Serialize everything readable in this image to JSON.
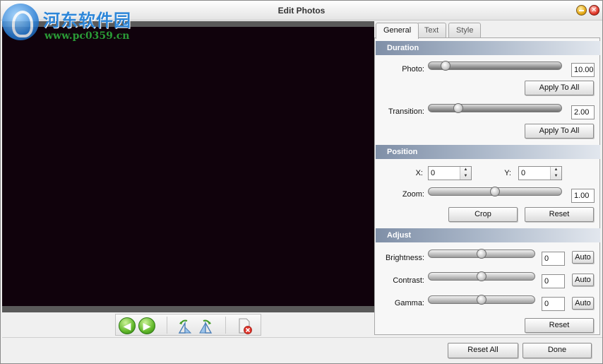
{
  "window": {
    "title": "Edit Photos"
  },
  "watermark": {
    "name": "河东软件园",
    "url": "www.pc0359.cn"
  },
  "tabs": [
    {
      "label": "General",
      "active": true
    },
    {
      "label": "Text",
      "active": false
    },
    {
      "label": "Style",
      "active": false
    }
  ],
  "duration": {
    "header": "Duration",
    "photo_label": "Photo:",
    "photo_value": "10.00",
    "photo_level": 0.1,
    "apply_photo_label": "Apply To All",
    "transition_label": "Transition:",
    "transition_value": "2.00",
    "transition_level": 0.2,
    "apply_transition_label": "Apply To All"
  },
  "position": {
    "header": "Position",
    "x_label": "X:",
    "x_value": "0",
    "y_label": "Y:",
    "y_value": "0",
    "zoom_label": "Zoom:",
    "zoom_value": "1.00",
    "zoom_level": 0.5,
    "crop_label": "Crop",
    "reset_label": "Reset"
  },
  "adjust": {
    "header": "Adjust",
    "brightness_label": "Brightness:",
    "brightness_value": "0",
    "brightness_level": 0.5,
    "contrast_label": "Contrast:",
    "contrast_value": "0",
    "contrast_level": 0.5,
    "gamma_label": "Gamma:",
    "gamma_value": "0",
    "gamma_level": 0.5,
    "auto_label": "Auto",
    "reset_label": "Reset"
  },
  "footer": {
    "reset_all_label": "Reset All",
    "done_label": "Done"
  },
  "icons": {
    "prev": "arrow-left-icon",
    "next": "arrow-right-icon",
    "rotate_left": "rotate-left-icon",
    "rotate_right": "rotate-right-icon",
    "delete": "delete-photo-icon"
  },
  "colors": {
    "preview_bg": "#10020c",
    "section_header": "#7f8fa7",
    "green_button": "#61b82a"
  }
}
